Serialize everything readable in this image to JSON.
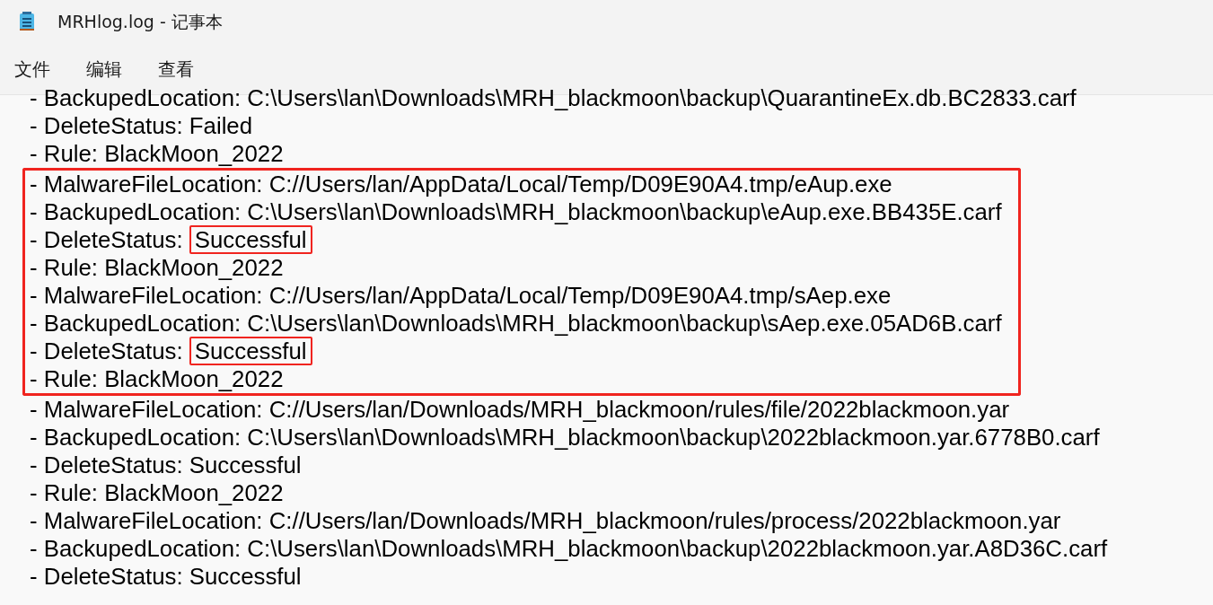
{
  "window": {
    "title": "MRHlog.log - 记事本"
  },
  "menu": [
    "文件",
    "编辑",
    "查看"
  ],
  "lines": [
    {
      "label": "- BackupedLocation: C:\\Users\\lan\\Downloads\\MRH_blackmoon\\backup\\QuarantineEx.db.BC2833.carf",
      "in_box": false
    },
    {
      "label": "- DeleteStatus: Failed",
      "in_box": false
    },
    {
      "label": "- Rule: BlackMoon_2022",
      "in_box": false
    },
    {
      "label": "- MalwareFileLocation: C://Users/lan/AppData/Local/Temp/D09E90A4.tmp/eAup.exe",
      "in_box": true
    },
    {
      "label": "- BackupedLocation: C:\\Users\\lan\\Downloads\\MRH_blackmoon\\backup\\eAup.exe.BB435E.carf",
      "in_box": true
    },
    {
      "label": "- DeleteStatus:",
      "value": "Successful",
      "value_boxed": true,
      "in_box": true
    },
    {
      "label": "- Rule: BlackMoon_2022",
      "in_box": true
    },
    {
      "label": "- MalwareFileLocation: C://Users/lan/AppData/Local/Temp/D09E90A4.tmp/sAep.exe",
      "in_box": true
    },
    {
      "label": "- BackupedLocation: C:\\Users\\lan\\Downloads\\MRH_blackmoon\\backup\\sAep.exe.05AD6B.carf",
      "in_box": true
    },
    {
      "label": "- DeleteStatus:",
      "value": "Successful",
      "value_boxed": true,
      "in_box": true
    },
    {
      "label": "- Rule: BlackMoon_2022",
      "in_box": true
    },
    {
      "label": "- MalwareFileLocation: C://Users/lan/Downloads/MRH_blackmoon/rules/file/2022blackmoon.yar",
      "in_box": false
    },
    {
      "label": "- BackupedLocation: C:\\Users\\lan\\Downloads\\MRH_blackmoon\\backup\\2022blackmoon.yar.6778B0.carf",
      "in_box": false
    },
    {
      "label": "- DeleteStatus: Successful",
      "in_box": false
    },
    {
      "label": "- Rule: BlackMoon_2022",
      "in_box": false
    },
    {
      "label": "- MalwareFileLocation: C://Users/lan/Downloads/MRH_blackmoon/rules/process/2022blackmoon.yar",
      "in_box": false
    },
    {
      "label": "- BackupedLocation: C:\\Users\\lan\\Downloads\\MRH_blackmoon\\backup\\2022blackmoon.yar.A8D36C.carf",
      "in_box": false
    },
    {
      "label": "- DeleteStatus: Successful",
      "in_box": false
    }
  ]
}
